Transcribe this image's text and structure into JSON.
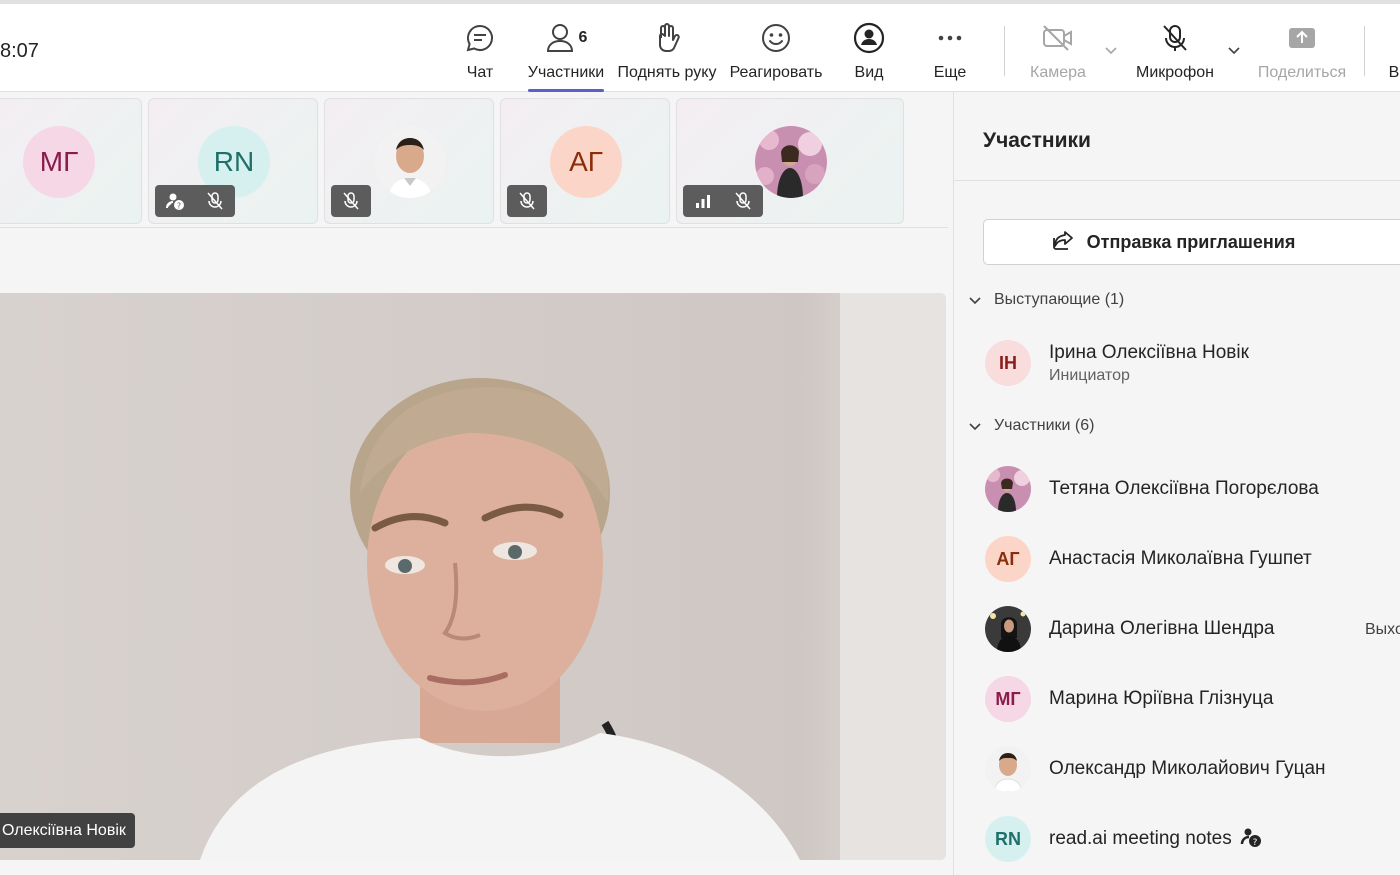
{
  "meeting": {
    "timer": "8:07",
    "self_label": "Олексіївна Новік"
  },
  "toolbar": {
    "chat": "Чат",
    "people": "Участники",
    "people_count": "6",
    "raise_hand": "Поднять руку",
    "react": "Реагировать",
    "view": "Вид",
    "more": "Еще",
    "camera": "Камера",
    "mic": "Микрофон",
    "share": "Поделиться",
    "leave_partial": "В"
  },
  "tiles": [
    {
      "initials": "МГ",
      "color": "#f6d7e6",
      "text_color": "#8a1c4c"
    },
    {
      "initials": "RN",
      "color": "#d6f0ef",
      "text_color": "#1f6f6a"
    },
    {
      "initials": "",
      "photo": "man"
    },
    {
      "initials": "АГ",
      "color": "#fbd6c8",
      "text_color": "#8a2d0b"
    },
    {
      "initials": "",
      "photo": "woman-flowers"
    }
  ],
  "panel": {
    "title": "Участники",
    "invite_label": "Отправка приглашения",
    "presenters_header": "Выступающие (1)",
    "attendees_header": "Участники (6)",
    "presenters": [
      {
        "initials": "ІН",
        "name": "Ірина Олексіївна Новік",
        "role": "Инициатор",
        "color": "#f9dcdc",
        "text_color": "#8a1c1c"
      }
    ],
    "attendees": [
      {
        "initials": "",
        "photo": "woman-flowers",
        "name": "Тетяна Олексіївна Погорєлова",
        "status": ""
      },
      {
        "initials": "АГ",
        "name": "Анастасія Миколаївна Гушпет",
        "color": "#fbd6c8",
        "text_color": "#8a2d0b",
        "status": ""
      },
      {
        "initials": "",
        "photo": "woman-dark",
        "name": "Дарина Олегівна Шендра",
        "status": "Выхо"
      },
      {
        "initials": "МГ",
        "name": "Марина Юріївна Глізнуца",
        "color": "#f6d7e6",
        "text_color": "#8a1c4c",
        "status": ""
      },
      {
        "initials": "",
        "photo": "man",
        "name": "Олександр Миколайович Гуцан",
        "status": ""
      },
      {
        "initials": "RN",
        "name": "read.ai meeting notes",
        "color": "#d6f0ef",
        "text_color": "#1f6f6a",
        "status": ""
      }
    ]
  }
}
